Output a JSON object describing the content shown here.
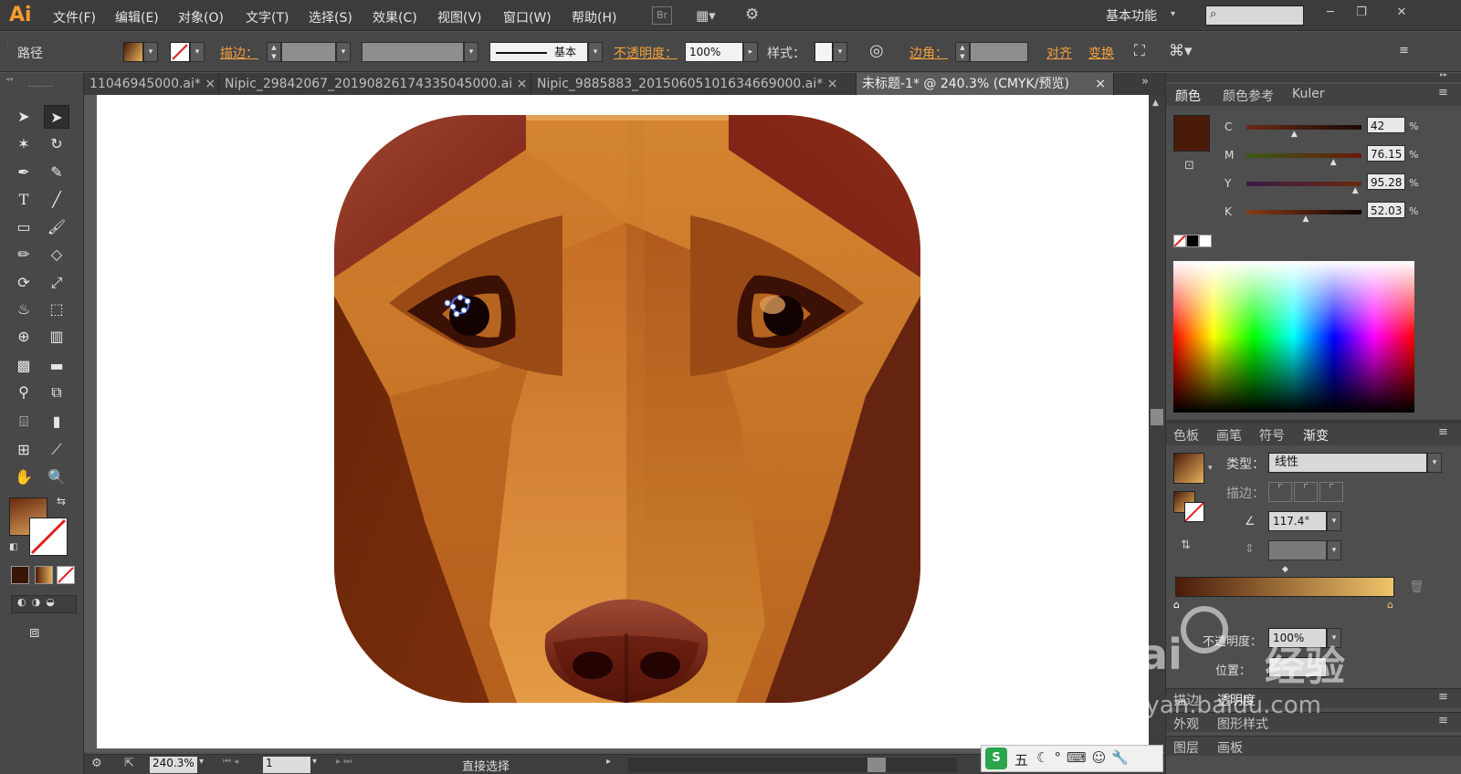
{
  "app": {
    "logo": "Ai",
    "workspace": "基本功能",
    "bridge": "Br"
  },
  "menu": [
    "文件(F)",
    "编辑(E)",
    "对象(O)",
    "文字(T)",
    "选择(S)",
    "效果(C)",
    "视图(V)",
    "窗口(W)",
    "帮助(H)"
  ],
  "control": {
    "object_type": "路径",
    "stroke_label": "描边：",
    "stroke_style": "基本",
    "opacity_label": "不透明度：",
    "opacity_value": "100%",
    "style_label": "样式：",
    "corner_label": "边角：",
    "align_label": "对齐",
    "transform_label": "变换"
  },
  "tabs": [
    {
      "label": "11046945000.ai*",
      "active": false
    },
    {
      "label": "Nipic_29842067_20190826174335045000.ai",
      "active": false
    },
    {
      "label": "Nipic_9885883_20150605101634669000.ai*",
      "active": false
    },
    {
      "label": "未标题-1* @ 240.3% (CMYK/预览)",
      "active": true
    }
  ],
  "color_panel": {
    "tabs": [
      "颜色",
      "颜色参考",
      "Kuler"
    ],
    "swatch_color": "#4b1b0a",
    "channels": [
      {
        "label": "C",
        "value": "42",
        "position": 0.42
      },
      {
        "label": "M",
        "value": "76.15",
        "position": 0.76
      },
      {
        "label": "Y",
        "value": "95.28",
        "position": 0.95
      },
      {
        "label": "K",
        "value": "52.03",
        "position": 0.52
      }
    ],
    "percent": "%"
  },
  "gradient_panel": {
    "tabs": [
      "色板",
      "画笔",
      "符号",
      "渐变"
    ],
    "type_label": "类型：",
    "type_value": "线性",
    "stroke_label": "描边：",
    "angle_value": "117.4°",
    "opacity_label": "不透明度：",
    "opacity_value": "100%",
    "location_label": "位置："
  },
  "lower_panels": {
    "row1": [
      "描边",
      "透明度"
    ],
    "row2": [
      "外观",
      "图形样式"
    ],
    "row3": [
      "图层",
      "画板"
    ]
  },
  "status": {
    "zoom": "240.3%",
    "page": "1",
    "tool": "直接选择"
  },
  "watermark": {
    "brand": "Bai",
    "brand2": "经验",
    "url": "jingyan.baidu.com"
  },
  "ime": {
    "label": "五"
  }
}
